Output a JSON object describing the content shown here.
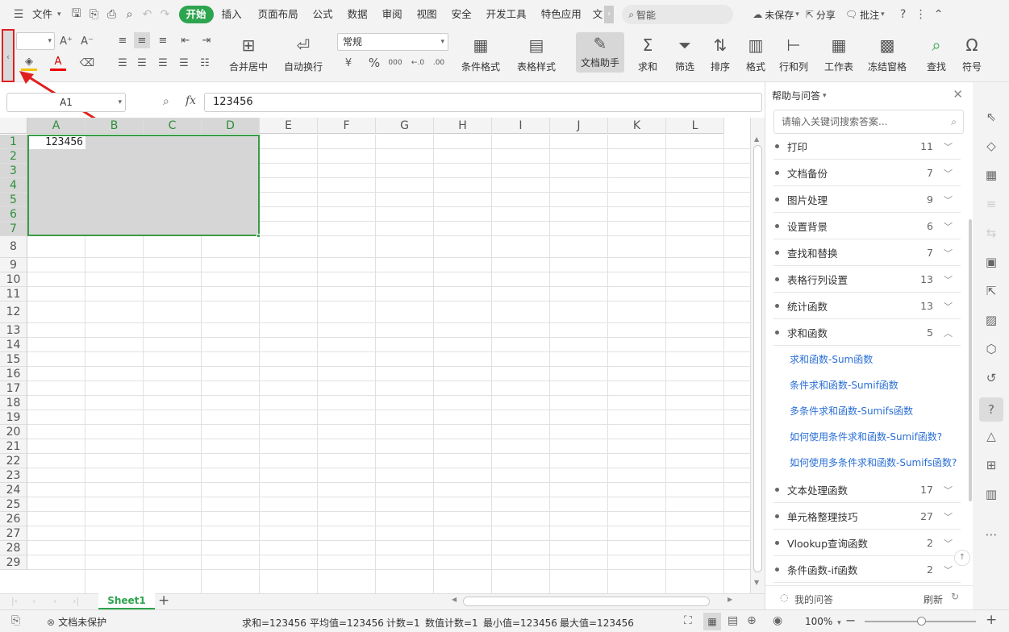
{
  "menubar": {
    "file_label": "文件",
    "tabs": [
      "开始",
      "插入",
      "页面布局",
      "公式",
      "数据",
      "审阅",
      "视图",
      "安全",
      "开发工具",
      "特色应用",
      "文"
    ],
    "active_tab": "开始",
    "search_label": "智能",
    "unsaved_label": "未保存",
    "share_label": "分享",
    "comment_label": "批注"
  },
  "ribbon": {
    "merge_center": "合并居中",
    "auto_wrap": "自动换行",
    "number_format": "常规",
    "conditional_format": "条件格式",
    "table_style": "表格样式",
    "doc_assistant": "文档助手",
    "sum": "求和",
    "filter": "筛选",
    "sort": "排序",
    "format": "格式",
    "row_col": "行和列",
    "worksheet": "工作表",
    "freeze": "冻结窗格",
    "find": "查找",
    "symbol": "符号",
    "percent": "%",
    "thousands": "000"
  },
  "formula_bar": {
    "name_box": "A1",
    "fx": "fx",
    "value": "123456"
  },
  "grid": {
    "columns": [
      "A",
      "B",
      "C",
      "D",
      "E",
      "F",
      "G",
      "H",
      "I",
      "J",
      "K",
      "L"
    ],
    "rows": [
      "1",
      "2",
      "3",
      "4",
      "5",
      "6",
      "7",
      "8",
      "9",
      "10",
      "11",
      "12",
      "13",
      "14",
      "15",
      "16",
      "17",
      "18",
      "19",
      "20",
      "21",
      "22",
      "23",
      "24",
      "25",
      "26",
      "27",
      "28",
      "29"
    ],
    "cell_a1": "123456"
  },
  "sheetbar": {
    "sheet_name": "Sheet1",
    "add_sheet": "+"
  },
  "statusbar": {
    "protect": "文档未保护",
    "sum": "求和=123456",
    "avg": "平均值=123456",
    "count": "计数=1",
    "num_count": "数值计数=1",
    "min": "最小值=123456",
    "max": "最大值=123456",
    "zoom": "100%"
  },
  "help": {
    "title": "帮助与问答",
    "search_placeholder": "请输入关键词搜索答案...",
    "items": [
      {
        "label": "打印",
        "count": "11"
      },
      {
        "label": "文档备份",
        "count": "7"
      },
      {
        "label": "图片处理",
        "count": "9"
      },
      {
        "label": "设置背景",
        "count": "6"
      },
      {
        "label": "查找和替换",
        "count": "7"
      },
      {
        "label": "表格行列设置",
        "count": "13"
      },
      {
        "label": "统计函数",
        "count": "13"
      },
      {
        "label": "求和函数",
        "count": "5"
      }
    ],
    "links": [
      "求和函数-Sum函数",
      "条件求和函数-Sumif函数",
      "多条件求和函数-Sumifs函数",
      "如何使用条件求和函数-Sumif函数?",
      "如何使用多条件求和函数-Sumifs函数?"
    ],
    "items2": [
      {
        "label": "文本处理函数",
        "count": "17"
      },
      {
        "label": "单元格整理技巧",
        "count": "27"
      },
      {
        "label": "Vlookup查询函数",
        "count": "2"
      },
      {
        "label": "条件函数-if函数",
        "count": "2"
      }
    ],
    "my_questions": "我的问答",
    "refresh": "刷新"
  }
}
